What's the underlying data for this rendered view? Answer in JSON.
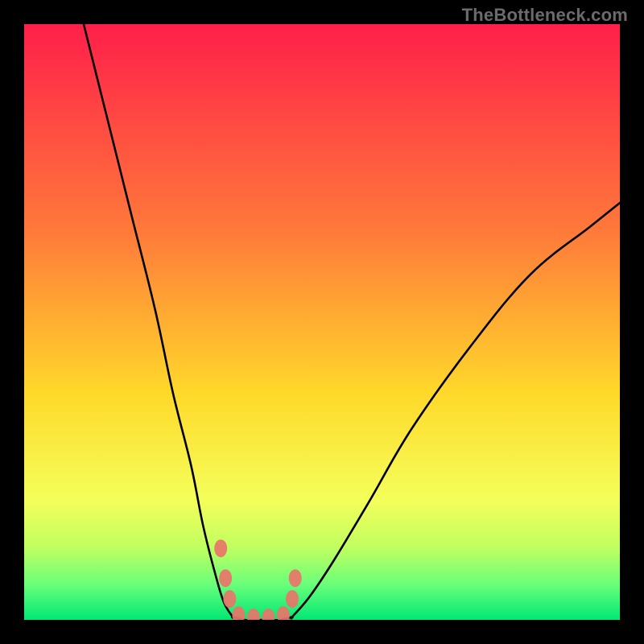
{
  "watermark": "TheBottleneck.com",
  "colors": {
    "top": "#ff1f4a",
    "mid1": "#ff7a3a",
    "mid2": "#ffd92a",
    "band1": "#f4ff5a",
    "band2": "#bfff60",
    "band3": "#6aff7a",
    "bottom": "#00e874",
    "frame": "#000000",
    "curve": "#000000",
    "marker": "#e9746a"
  },
  "chart_data": {
    "type": "line",
    "title": "",
    "xlabel": "",
    "ylabel": "",
    "xlim": [
      0,
      100
    ],
    "ylim": [
      0,
      100
    ],
    "notes": "Figure is a qualitative bottleneck V-curve against a red→green vertical gradient. No axes, ticks, or numeric labels are rendered, so values below are visual estimates from pixel position.",
    "series": [
      {
        "name": "left-branch",
        "x": [
          10,
          14,
          18,
          22,
          25,
          28,
          30,
          32,
          33.5,
          35
        ],
        "y": [
          100,
          84,
          68,
          52,
          38,
          26,
          16,
          8,
          3,
          0.5
        ]
      },
      {
        "name": "valley-floor",
        "x": [
          35,
          37,
          39,
          41,
          43,
          45
        ],
        "y": [
          0.5,
          0,
          0,
          0,
          0,
          0.5
        ]
      },
      {
        "name": "right-branch",
        "x": [
          45,
          48,
          52,
          58,
          65,
          75,
          85,
          95,
          100
        ],
        "y": [
          0.5,
          4,
          10,
          20,
          32,
          46,
          58,
          66,
          70
        ]
      }
    ],
    "markers": [
      {
        "name": "left-marker-upper",
        "x": 33.0,
        "y": 12
      },
      {
        "name": "left-marker-mid",
        "x": 33.8,
        "y": 7
      },
      {
        "name": "left-marker-lower",
        "x": 34.5,
        "y": 3.5
      },
      {
        "name": "right-marker-upper",
        "x": 45.5,
        "y": 7
      },
      {
        "name": "right-marker-lower",
        "x": 45.0,
        "y": 3.5
      },
      {
        "name": "valley-marker-1",
        "x": 36,
        "y": 0.8
      },
      {
        "name": "valley-marker-2",
        "x": 38.5,
        "y": 0.4
      },
      {
        "name": "valley-marker-3",
        "x": 41,
        "y": 0.4
      },
      {
        "name": "valley-marker-4",
        "x": 43.5,
        "y": 0.8
      }
    ]
  }
}
